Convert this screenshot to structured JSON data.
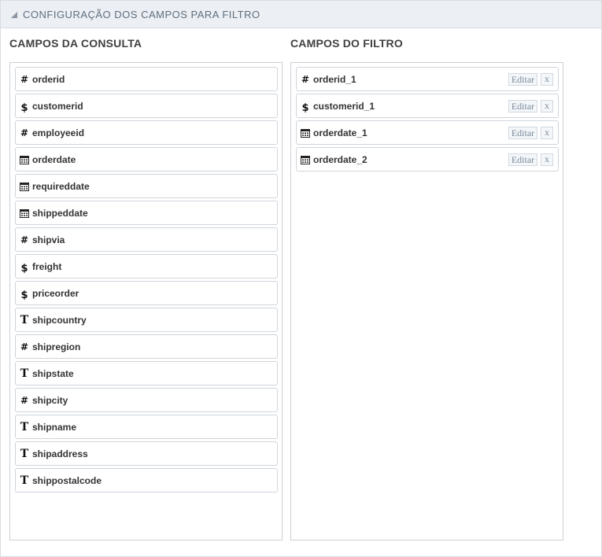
{
  "header": {
    "title": "CONFIGURAÇÃO DOS CAMPOS PARA FILTRO"
  },
  "query_fields": {
    "title": "CAMPOS DA CONSULTA",
    "items": [
      {
        "label": "orderid",
        "icon": "hash-icon"
      },
      {
        "label": "customerid",
        "icon": "dollar-icon"
      },
      {
        "label": "employeeid",
        "icon": "hash-icon"
      },
      {
        "label": "orderdate",
        "icon": "calendar-icon"
      },
      {
        "label": "requireddate",
        "icon": "calendar-icon"
      },
      {
        "label": "shippeddate",
        "icon": "calendar-icon"
      },
      {
        "label": "shipvia",
        "icon": "hash-icon"
      },
      {
        "label": "freight",
        "icon": "dollar-icon"
      },
      {
        "label": "priceorder",
        "icon": "dollar-icon"
      },
      {
        "label": "shipcountry",
        "icon": "text-icon"
      },
      {
        "label": "shipregion",
        "icon": "hash-icon"
      },
      {
        "label": "shipstate",
        "icon": "text-icon"
      },
      {
        "label": "shipcity",
        "icon": "hash-icon"
      },
      {
        "label": "shipname",
        "icon": "text-icon"
      },
      {
        "label": "shipaddress",
        "icon": "text-icon"
      },
      {
        "label": "shippostalcode",
        "icon": "text-icon"
      }
    ]
  },
  "filter_fields": {
    "title": "CAMPOS DO FILTRO",
    "edit_label": "Editar",
    "remove_label": "x",
    "items": [
      {
        "label": "orderid_1",
        "icon": "hash-icon"
      },
      {
        "label": "customerid_1",
        "icon": "dollar-icon"
      },
      {
        "label": "orderdate_1",
        "icon": "calendar-icon"
      },
      {
        "label": "orderdate_2",
        "icon": "calendar-icon"
      }
    ]
  },
  "colors": {
    "header_bg": "#eceff3",
    "header_text": "#5f6f80",
    "border": "#cfd5dc"
  }
}
